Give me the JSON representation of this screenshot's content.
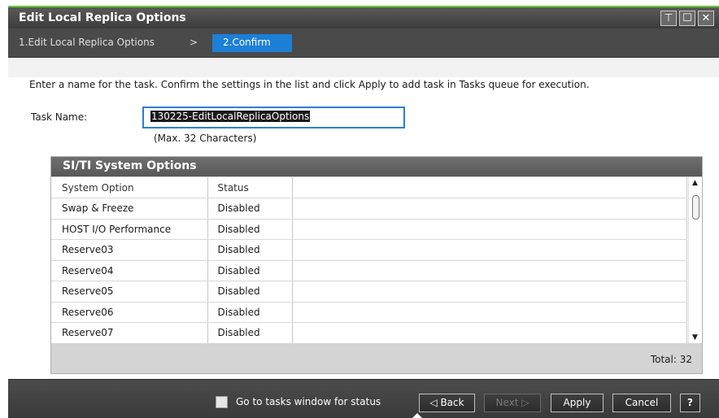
{
  "window": {
    "title": "Edit Local Replica Options",
    "controls": {
      "pin": "⊤",
      "maximize": "☐",
      "close": "✕"
    }
  },
  "steps": {
    "step1": "1.Edit Local Replica Options",
    "separator": ">",
    "step2": "2.Confirm"
  },
  "instructions": "Enter a name for the task. Confirm the settings in the list and click Apply to add task in Tasks queue for execution.",
  "task": {
    "label": "Task Name:",
    "value": "130225-EditLocalReplicaOptions",
    "hint": "(Max. 32 Characters)"
  },
  "panel": {
    "title": "SI/TI System Options",
    "columns": [
      "System Option",
      "Status"
    ],
    "rows": [
      {
        "option": "Swap & Freeze",
        "status": "Disabled"
      },
      {
        "option": "HOST I/O Performance",
        "status": "Disabled"
      },
      {
        "option": "Reserve03",
        "status": "Disabled"
      },
      {
        "option": "Reserve04",
        "status": "Disabled"
      },
      {
        "option": "Reserve05",
        "status": "Disabled"
      },
      {
        "option": "Reserve06",
        "status": "Disabled"
      },
      {
        "option": "Reserve07",
        "status": "Disabled"
      }
    ],
    "total_label": "Total:",
    "total_value": "32"
  },
  "footer": {
    "checkbox_label": "Go to tasks window for status",
    "back": "◁ Back",
    "next": "Next ▷",
    "apply": "Apply",
    "cancel": "Cancel",
    "help": "?"
  }
}
